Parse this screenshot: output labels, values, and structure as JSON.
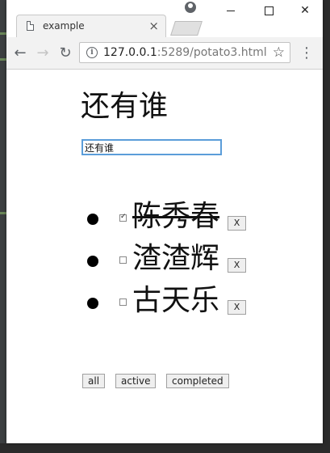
{
  "browser": {
    "tab_title": "example",
    "tab_close": "×",
    "url_host": "127.0.0.1",
    "url_rest": ":5289/potato3.html",
    "info_icon_glyph": "i",
    "star_glyph": "☆",
    "back_glyph": "←",
    "forward_glyph": "→",
    "reload_glyph": "↻",
    "menu_glyph": "⋮",
    "close_glyph": "✕"
  },
  "page": {
    "heading": "还有谁",
    "new_todo_value": "还有谁",
    "todos": [
      {
        "text": "陈秀春",
        "completed": true,
        "delete_label": "X"
      },
      {
        "text": "渣渣辉",
        "completed": false,
        "delete_label": "X"
      },
      {
        "text": "古天乐",
        "completed": false,
        "delete_label": "X"
      }
    ],
    "filters": {
      "all": "all",
      "active": "active",
      "completed": "completed"
    }
  },
  "icons": {
    "tab": "document-icon",
    "profile": "profile-icon",
    "star": "bookmark-star-icon"
  }
}
